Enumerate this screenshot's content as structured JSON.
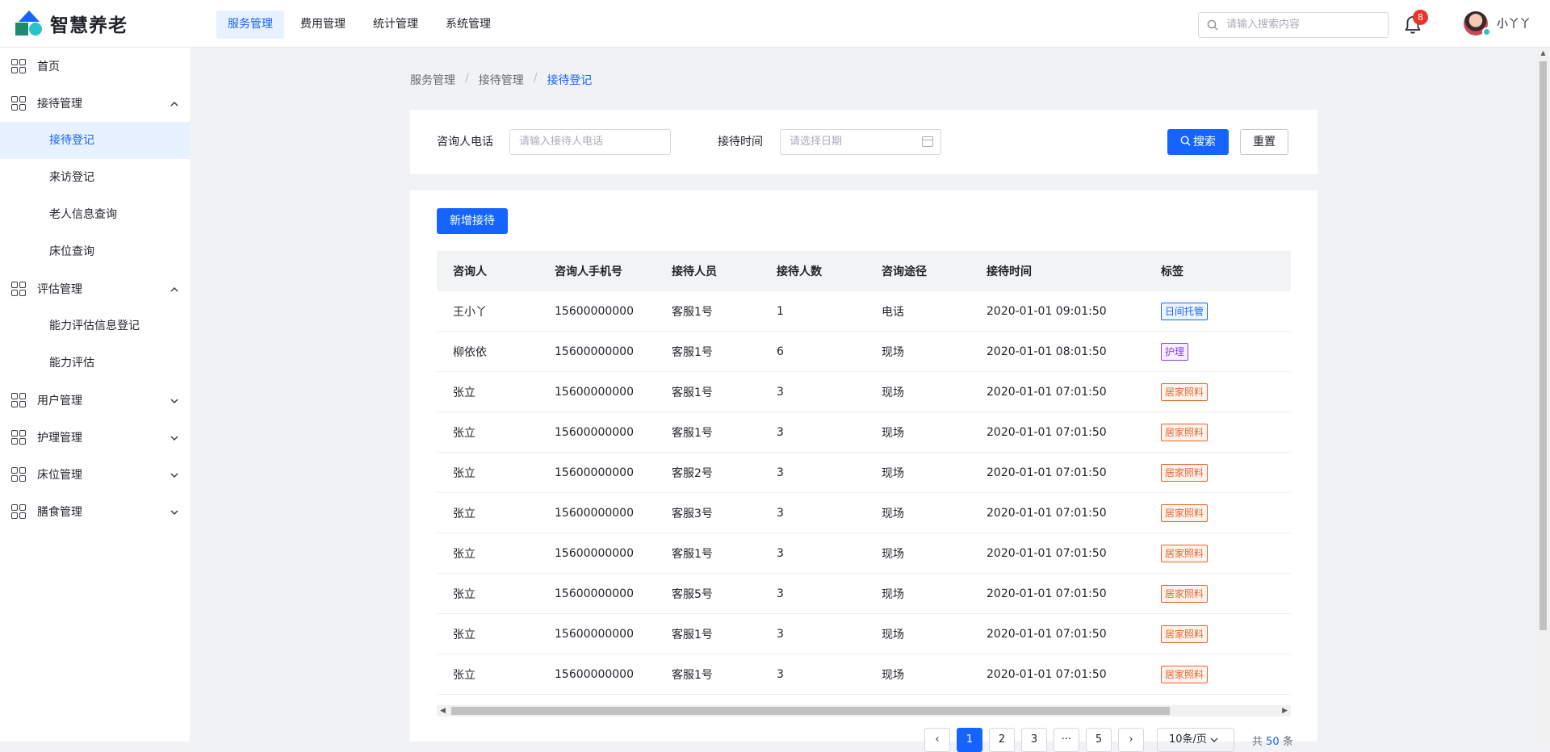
{
  "app": {
    "name": "智慧养老"
  },
  "topnav": [
    {
      "label": "服务管理",
      "active": true
    },
    {
      "label": "费用管理",
      "active": false
    },
    {
      "label": "统计管理",
      "active": false
    },
    {
      "label": "系统管理",
      "active": false
    }
  ],
  "header": {
    "search_placeholder": "请输入搜索内容",
    "notification_count": "8",
    "username": "小丫丫"
  },
  "sidebar": [
    {
      "label": "首页",
      "expanded": null,
      "children": []
    },
    {
      "label": "接待管理",
      "expanded": true,
      "children": [
        {
          "label": "接待登记",
          "active": true
        },
        {
          "label": "来访登记",
          "active": false
        },
        {
          "label": "老人信息查询",
          "active": false
        },
        {
          "label": "床位查询",
          "active": false
        }
      ]
    },
    {
      "label": "评估管理",
      "expanded": true,
      "children": [
        {
          "label": "能力评估信息登记",
          "active": false
        },
        {
          "label": "能力评估",
          "active": false
        }
      ]
    },
    {
      "label": "用户管理",
      "expanded": false,
      "children": []
    },
    {
      "label": "护理管理",
      "expanded": false,
      "children": []
    },
    {
      "label": "床位管理",
      "expanded": false,
      "children": []
    },
    {
      "label": "膳食管理",
      "expanded": false,
      "children": []
    }
  ],
  "breadcrumb": [
    "服务管理",
    "接待管理",
    "接待登记"
  ],
  "filter": {
    "phone_label": "咨询人电话",
    "phone_placeholder": "请输入接待人电话",
    "time_label": "接待时间",
    "time_placeholder": "请选择日期",
    "search_label": "搜索",
    "reset_label": "重置"
  },
  "add_button_label": "新增接待",
  "table": {
    "columns": [
      "咨询人",
      "咨询人手机号",
      "接待人员",
      "接待人数",
      "咨询途径",
      "接待时间",
      "标签"
    ],
    "rows": [
      {
        "name": "王小丫",
        "phone": "15600000000",
        "staff": "客服1号",
        "count": "1",
        "channel": "电话",
        "time": "2020-01-01 09:01:50",
        "tag": "日间托管",
        "tag_color": "#1664ff"
      },
      {
        "name": "柳依依",
        "phone": "15600000000",
        "staff": "客服1号",
        "count": "6",
        "channel": "现场",
        "time": "2020-01-01 08:01:50",
        "tag": "护理",
        "tag_color": "#8b3ff0"
      },
      {
        "name": "张立",
        "phone": "15600000000",
        "staff": "客服1号",
        "count": "3",
        "channel": "现场",
        "time": "2020-01-01 07:01:50",
        "tag": "居家照料",
        "tag_color": "#e8642a"
      },
      {
        "name": "张立",
        "phone": "15600000000",
        "staff": "客服1号",
        "count": "3",
        "channel": "现场",
        "time": "2020-01-01 07:01:50",
        "tag": "居家照料",
        "tag_color": "#e8642a"
      },
      {
        "name": "张立",
        "phone": "15600000000",
        "staff": "客服2号",
        "count": "3",
        "channel": "现场",
        "time": "2020-01-01 07:01:50",
        "tag": "居家照料",
        "tag_color": "#e8642a"
      },
      {
        "name": "张立",
        "phone": "15600000000",
        "staff": "客服3号",
        "count": "3",
        "channel": "现场",
        "time": "2020-01-01 07:01:50",
        "tag": "居家照料",
        "tag_color": "#e8642a"
      },
      {
        "name": "张立",
        "phone": "15600000000",
        "staff": "客服1号",
        "count": "3",
        "channel": "现场",
        "time": "2020-01-01 07:01:50",
        "tag": "居家照料",
        "tag_color": "#e8642a"
      },
      {
        "name": "张立",
        "phone": "15600000000",
        "staff": "客服5号",
        "count": "3",
        "channel": "现场",
        "time": "2020-01-01 07:01:50",
        "tag": "居家照料",
        "tag_color": "#e8642a"
      },
      {
        "name": "张立",
        "phone": "15600000000",
        "staff": "客服1号",
        "count": "3",
        "channel": "现场",
        "time": "2020-01-01 07:01:50",
        "tag": "居家照料",
        "tag_color": "#e8642a"
      },
      {
        "name": "张立",
        "phone": "15600000000",
        "staff": "客服1号",
        "count": "3",
        "channel": "现场",
        "time": "2020-01-01 07:01:50",
        "tag": "居家照料",
        "tag_color": "#e8642a"
      }
    ]
  },
  "pagination": {
    "pages": [
      "1",
      "2",
      "3",
      "···",
      "5"
    ],
    "current": "1",
    "page_size": "10条/页",
    "total_prefix": "共",
    "total": "50",
    "total_suffix": "条"
  }
}
